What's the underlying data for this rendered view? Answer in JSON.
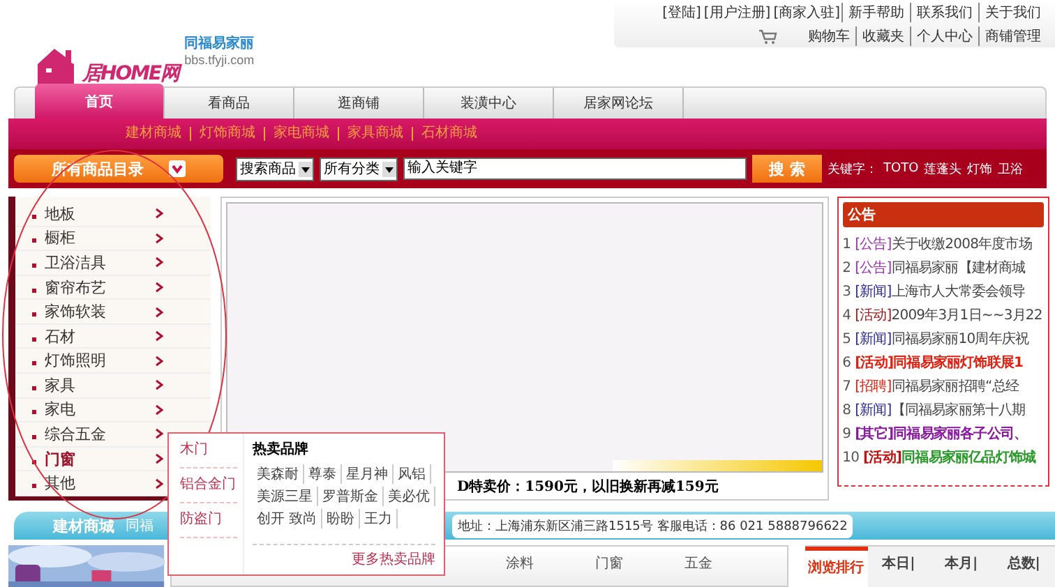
{
  "logo": {
    "name": "同福易家丽",
    "url": "bbs.tfyji.com",
    "mark": "居HOME网"
  },
  "top_links": {
    "account": [
      "[登陆]",
      "[用户注册]",
      "[商家入驻]"
    ],
    "info": [
      "新手帮助",
      "联系我们",
      "关于我们"
    ],
    "user": [
      "购物车",
      "收藏夹",
      "个人中心",
      "商铺管理"
    ]
  },
  "main_tabs": [
    {
      "label": "首页",
      "selected": true
    },
    {
      "label": "看商品",
      "selected": false
    },
    {
      "label": "逛商铺",
      "selected": false
    },
    {
      "label": "装潢中心",
      "selected": false
    },
    {
      "label": "居家网论坛",
      "selected": false
    }
  ],
  "sub_nav": [
    "建材商城",
    "灯饰商城",
    "家电商城",
    "家具商城",
    "石材商城"
  ],
  "search": {
    "catalog": "所有商品目录",
    "scope": "搜索商品",
    "category": "所有分类",
    "value": "输入关键字",
    "button": "搜 索",
    "keywords_label": "关键字：",
    "keywords": [
      "TOTO",
      "莲蓬头",
      "灯饰",
      "卫浴"
    ]
  },
  "categories": [
    {
      "label": "地板",
      "selected": false
    },
    {
      "label": "橱柜",
      "selected": false
    },
    {
      "label": "卫浴洁具",
      "selected": false
    },
    {
      "label": "窗帘布艺",
      "selected": false
    },
    {
      "label": "家饰软装",
      "selected": false
    },
    {
      "label": "石材",
      "selected": false
    },
    {
      "label": "灯饰照明",
      "selected": false
    },
    {
      "label": "家具",
      "selected": false
    },
    {
      "label": "家电",
      "selected": false
    },
    {
      "label": "综合五金",
      "selected": false
    },
    {
      "label": "门窗",
      "selected": true
    },
    {
      "label": "其他",
      "selected": false
    }
  ],
  "flyout": {
    "types": [
      "木门",
      "铝合金门",
      "防盗门"
    ],
    "brands_title": "热卖品牌",
    "brand_rows": [
      [
        "美森耐",
        "尊泰",
        "星月神",
        "风铝"
      ],
      [
        "美源三星",
        "罗普斯金",
        "美必优"
      ],
      [
        "创开 致尚",
        "盼盼",
        "王力"
      ]
    ],
    "more": "更多热卖品牌"
  },
  "promo": "D特卖价：1590元，以旧换新再减159元",
  "notices": {
    "title": "公告",
    "items": [
      {
        "num": "1",
        "tag": {
          "label": "[公告]",
          "color": "#9b30b0"
        },
        "text": "关于收缴2008年度市场",
        "color": "#444444",
        "bold": false
      },
      {
        "num": "2",
        "tag": {
          "label": "[公告]",
          "color": "#9b30b0"
        },
        "text": "同福易家丽【建材商城",
        "color": "#444444",
        "bold": false
      },
      {
        "num": "3",
        "tag": {
          "label": "[新闻]",
          "color": "#2a2a9a"
        },
        "text": "上海市人大常委会领导",
        "color": "#444444",
        "bold": false
      },
      {
        "num": "4",
        "tag": {
          "label": "[活动]",
          "color": "#a01818"
        },
        "text": "2009年3月1日~~3月22",
        "color": "#444444",
        "bold": false
      },
      {
        "num": "5",
        "tag": {
          "label": "[新闻]",
          "color": "#2a2a9a"
        },
        "text": "同福易家丽10周年庆祝",
        "color": "#444444",
        "bold": false
      },
      {
        "num": "6",
        "tag": {
          "label": "[活动]",
          "color": "#e02010"
        },
        "text": "同福易家丽灯饰联展1",
        "color": "#e02010",
        "bold": true
      },
      {
        "num": "7",
        "tag": {
          "label": "[招聘]",
          "color": "#e02010"
        },
        "text": "同福易家丽招聘“总经",
        "color": "#444444",
        "bold": false
      },
      {
        "num": "8",
        "tag": {
          "label": "[新闻]",
          "color": "#2a2a9a"
        },
        "text": "【同福易家丽第十八期",
        "color": "#444444",
        "bold": false
      },
      {
        "num": "9",
        "tag": {
          "label": "[其它]",
          "color": "#8a1aa0"
        },
        "text": "同福易家丽各子公司、",
        "color": "#8a1aa0",
        "bold": true
      },
      {
        "num": "10",
        "tag": {
          "label": "[活动]",
          "color": "#c01010"
        },
        "text": "同福易家丽亿品灯饰城",
        "color": "#2a9a2a",
        "bold": true
      }
    ]
  },
  "banner": {
    "title": "建材商城",
    "fragment": "同福",
    "address": "地址：上海浦东新区浦三路1515号  客服电话：86 021 5888796622"
  },
  "product_tabs": [
    "涂料",
    "门窗",
    "五金"
  ],
  "rank_tabs": [
    {
      "label": "浏览排行",
      "selected": true
    },
    {
      "label": "本日|",
      "selected": false
    },
    {
      "label": "本月|",
      "selected": false
    },
    {
      "label": "总数|",
      "selected": false
    }
  ]
}
